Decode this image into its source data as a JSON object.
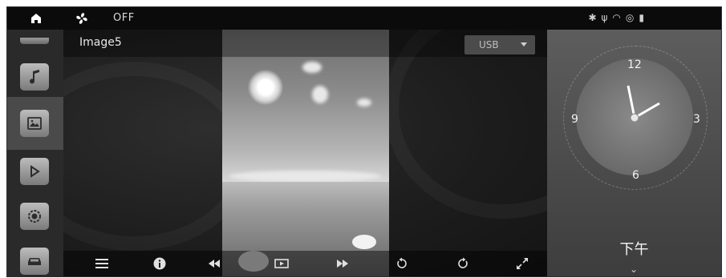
{
  "status": {
    "fan_state": "OFF",
    "icons": [
      "bluetooth-icon",
      "usb-icon",
      "wifi-icon",
      "battery-icon",
      "signal-icon"
    ]
  },
  "sidebar": {
    "items": [
      {
        "name": "music",
        "icon": "music-note-icon",
        "active": false
      },
      {
        "name": "gallery",
        "icon": "image-icon",
        "active": true
      },
      {
        "name": "video",
        "icon": "play-icon",
        "active": false
      },
      {
        "name": "settings",
        "icon": "settings-icon",
        "active": false
      },
      {
        "name": "car",
        "icon": "car-icon",
        "active": false
      }
    ]
  },
  "viewer": {
    "image_title": "Image5",
    "source": "USB",
    "controls": [
      "menu-icon",
      "info-icon",
      "rewind-icon",
      "slideshow-icon",
      "forward-icon",
      "rotate-left-icon",
      "rotate-right-icon",
      "fullscreen-icon"
    ]
  },
  "clock": {
    "numbers": {
      "twelve": "12",
      "three": "3",
      "six": "6",
      "nine": "9"
    },
    "period": "下午"
  },
  "colors": {
    "background": "#1a1a1a",
    "sidebar": "#2a2a2a",
    "accent": "#ffffff"
  }
}
